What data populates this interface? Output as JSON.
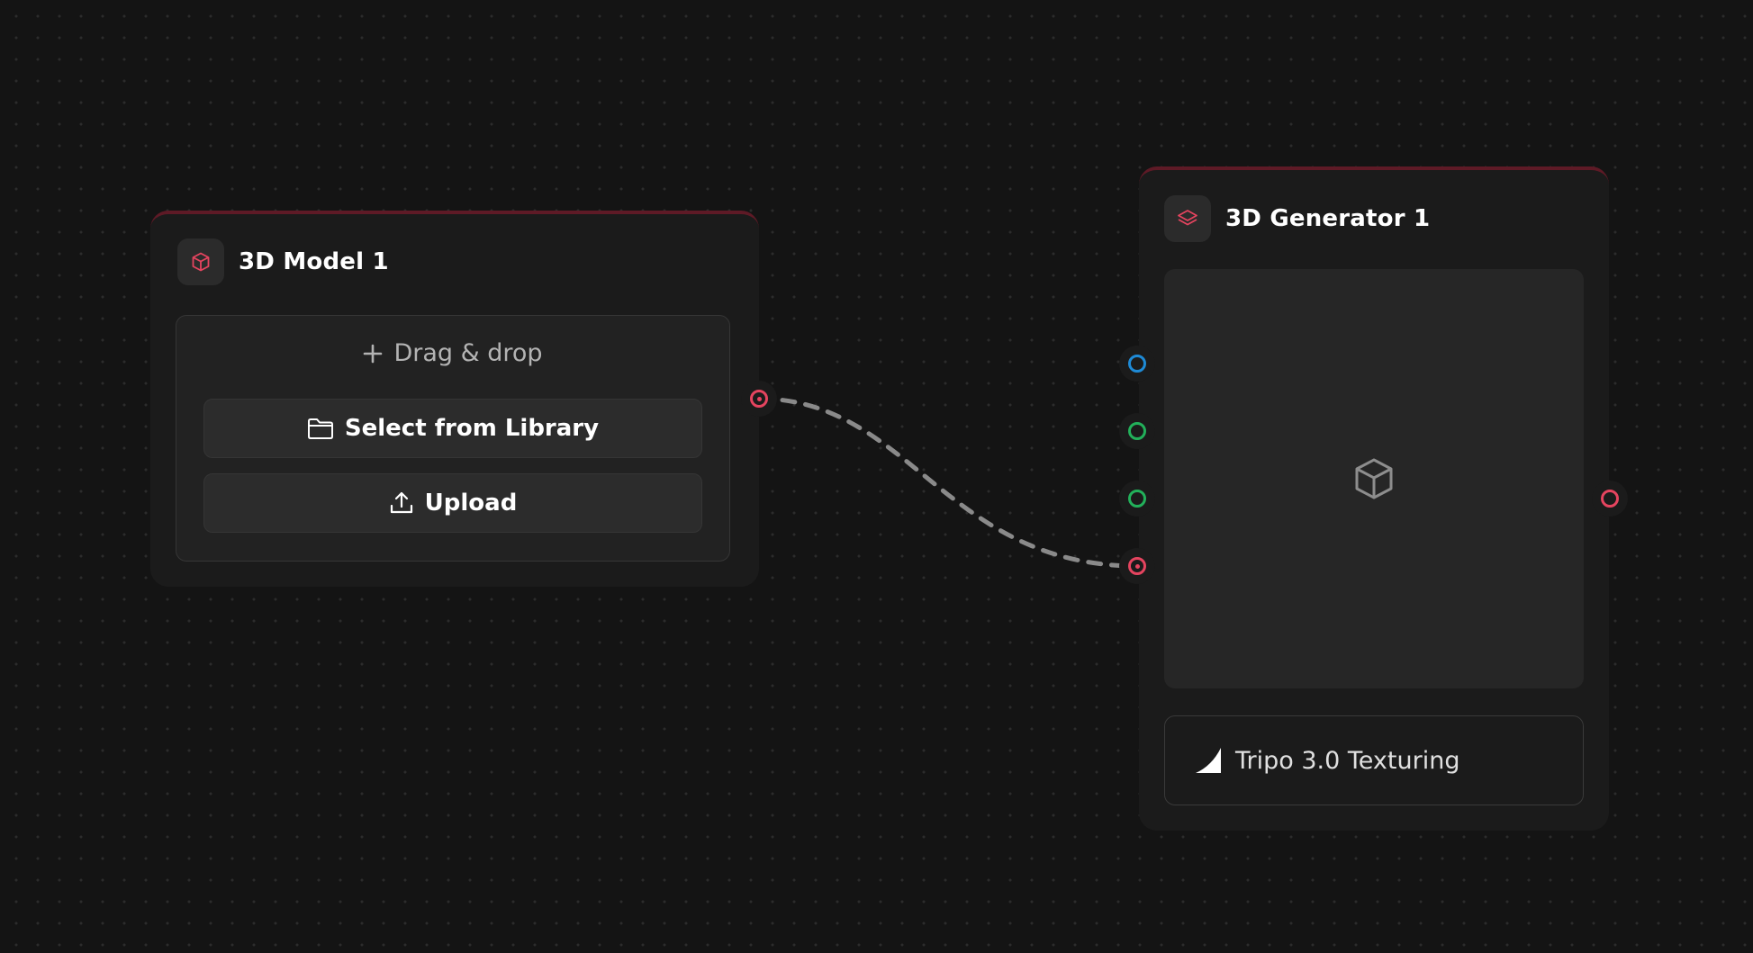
{
  "nodes": {
    "model_node": {
      "title": "3D Model 1",
      "icon": "cube-icon",
      "dropzone_label": "Drag & drop",
      "library_button": "Select from Library",
      "upload_button": "Upload"
    },
    "generator_node": {
      "title": "3D Generator 1",
      "icon": "layers-icon",
      "preview_icon": "cube-outline-icon",
      "model_label": "Tripo 3.0 Texturing",
      "model_logo": "tripo-logo-icon"
    }
  },
  "colors": {
    "canvas_bg": "#141414",
    "node_bg": "#1b1b1b",
    "accent_red": "#e5445f",
    "port_blue": "#1e8ad6",
    "port_green": "#22b05a",
    "edge": "#8a8a8a"
  }
}
